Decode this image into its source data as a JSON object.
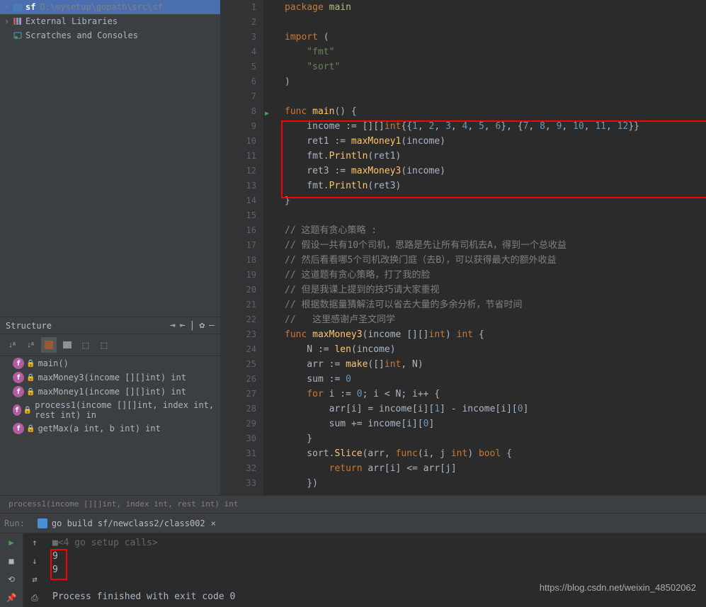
{
  "project": {
    "root_name": "sf",
    "root_path": "D:\\mysetup\\gopath\\src\\sf",
    "external_libs": "External Libraries",
    "scratches": "Scratches and Consoles"
  },
  "structure": {
    "title": "Structure",
    "items": [
      {
        "name": "main()",
        "kind": "f"
      },
      {
        "name": "maxMoney3(income [][]int) int",
        "kind": "f"
      },
      {
        "name": "maxMoney1(income [][]int) int",
        "kind": "f"
      },
      {
        "name": "process1(income [][]int, index int, rest int) in",
        "kind": "f"
      },
      {
        "name": "getMax(a int, b int) int",
        "kind": "f"
      }
    ]
  },
  "code": {
    "lines": [
      {
        "n": 1,
        "html": "<span class='kw'>package</span> <span class='pkg'>main</span>"
      },
      {
        "n": 2,
        "html": ""
      },
      {
        "n": 3,
        "html": "<span class='kw'>import</span> ("
      },
      {
        "n": 4,
        "html": "    <span class='str'>\"fmt\"</span>"
      },
      {
        "n": 5,
        "html": "    <span class='str'>\"sort\"</span>"
      },
      {
        "n": 6,
        "html": ")"
      },
      {
        "n": 7,
        "html": ""
      },
      {
        "n": 8,
        "html": "<span class='kw'>func</span> <span class='fn'>main</span>() {",
        "run": true
      },
      {
        "n": 9,
        "html": "    income := [][]<span class='ty'>int</span>{{<span class='num'>1</span>, <span class='num'>2</span>, <span class='num'>3</span>, <span class='num'>4</span>, <span class='num'>5</span>, <span class='num'>6</span>}, {<span class='num'>7</span>, <span class='num'>8</span>, <span class='num'>9</span>, <span class='num'>10</span>, <span class='num'>11</span>, <span class='num'>12</span>}}"
      },
      {
        "n": 10,
        "html": "    ret1 := <span class='fn'>maxMoney1</span>(income)"
      },
      {
        "n": 11,
        "html": "    fmt.<span class='fn'>Println</span>(ret1)"
      },
      {
        "n": 12,
        "html": "    ret3 := <span class='fn'>maxMoney3</span>(income)"
      },
      {
        "n": 13,
        "html": "    fmt.<span class='fn'>Println</span>(ret3)"
      },
      {
        "n": 14,
        "html": "}"
      },
      {
        "n": 15,
        "html": ""
      },
      {
        "n": 16,
        "html": "<span class='cm'>// 这题有贪心策略 :</span>"
      },
      {
        "n": 17,
        "html": "<span class='cm'>// 假设一共有10个司机，思路是先让所有司机去A，得到一个总收益</span>"
      },
      {
        "n": 18,
        "html": "<span class='cm'>// 然后看看哪5个司机改换门庭（去B），可以获得最大的额外收益</span>"
      },
      {
        "n": 19,
        "html": "<span class='cm'>// 这道题有贪心策略，打了我的脸</span>"
      },
      {
        "n": 20,
        "html": "<span class='cm'>// 但是我课上提到的技巧请大家重视</span>"
      },
      {
        "n": 21,
        "html": "<span class='cm'>// 根据数据量猜解法可以省去大量的多余分析，节省时间</span>"
      },
      {
        "n": 22,
        "html": "<span class='cm'>//   这里感谢卢圣文同学</span>"
      },
      {
        "n": 23,
        "html": "<span class='kw'>func</span> <span class='fn'>maxMoney3</span>(income [][]<span class='ty'>int</span>) <span class='ty'>int</span> {"
      },
      {
        "n": 24,
        "html": "    N := <span class='fn'>len</span>(income)"
      },
      {
        "n": 25,
        "html": "    arr := <span class='fn'>make</span>([]<span class='ty'>int</span>, N)"
      },
      {
        "n": 26,
        "html": "    sum := <span class='num'>0</span>"
      },
      {
        "n": 27,
        "html": "    <span class='kw'>for</span> i := <span class='num'>0</span>; i &lt; N; i++ {"
      },
      {
        "n": 28,
        "html": "        arr[i] = income[i][<span class='num'>1</span>] - income[i][<span class='num'>0</span>]"
      },
      {
        "n": 29,
        "html": "        sum += income[i][<span class='num'>0</span>]"
      },
      {
        "n": 30,
        "html": "    }"
      },
      {
        "n": 31,
        "html": "    sort.<span class='fn'>Slice</span>(arr, <span class='kw'>func</span>(i, j <span class='ty'>int</span>) <span class='ty'>bool</span> {"
      },
      {
        "n": 32,
        "html": "        <span class='kw'>return</span> arr[i] &lt;= arr[j]"
      },
      {
        "n": 33,
        "html": "    })"
      }
    ]
  },
  "breadcrumb": "process1(income [][]int, index int, rest int) int",
  "run": {
    "label": "Run:",
    "tab": "go build sf/newclass2/class002",
    "setup_calls": "<4 go setup calls>",
    "output": [
      "9",
      "9"
    ],
    "finished": "Process finished with exit code 0"
  },
  "watermark": "https://blog.csdn.net/weixin_48502062"
}
